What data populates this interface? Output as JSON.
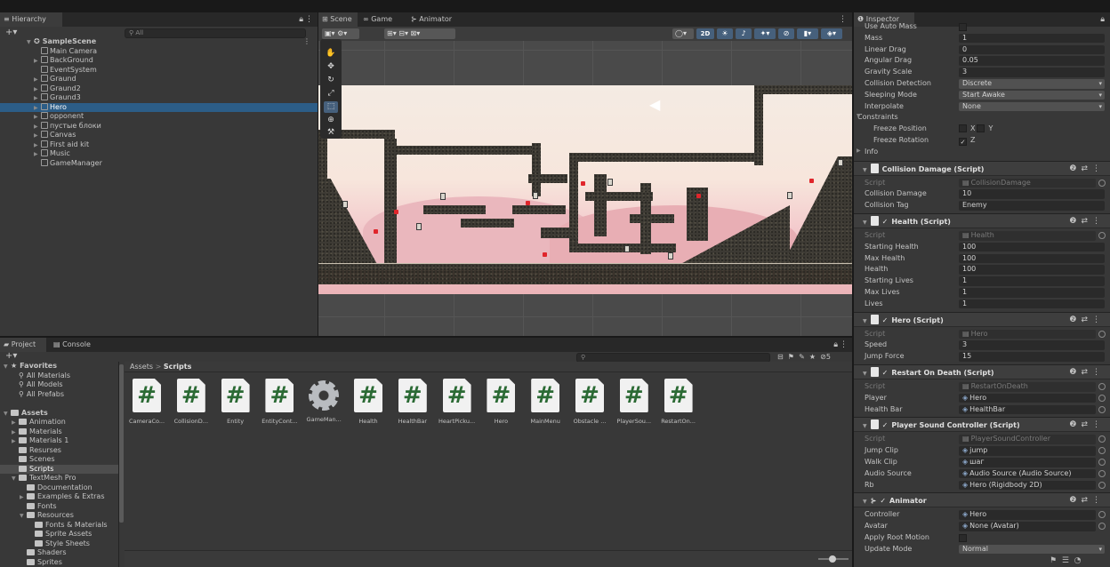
{
  "hierarchy": {
    "tab": "Hierarchy",
    "search_placeholder": "All",
    "items": [
      {
        "label": "SampleScene",
        "expand": "▼",
        "kind": "scene",
        "depth": 0
      },
      {
        "label": "Main Camera",
        "expand": "",
        "kind": "obj",
        "depth": 1
      },
      {
        "label": "BackGround",
        "expand": "▶",
        "kind": "obj",
        "depth": 1
      },
      {
        "label": "EventSystem",
        "expand": "",
        "kind": "obj",
        "depth": 1
      },
      {
        "label": "Graund",
        "expand": "▶",
        "kind": "obj",
        "depth": 1
      },
      {
        "label": "Graund2",
        "expand": "▶",
        "kind": "obj",
        "depth": 1
      },
      {
        "label": "Graund3",
        "expand": "▶",
        "kind": "obj",
        "depth": 1
      },
      {
        "label": "Hero",
        "expand": "▶",
        "kind": "obj",
        "depth": 1,
        "selected": true
      },
      {
        "label": "opponent",
        "expand": "▶",
        "kind": "obj",
        "depth": 1
      },
      {
        "label": "пустые блоки",
        "expand": "▶",
        "kind": "obj",
        "depth": 1
      },
      {
        "label": "Canvas",
        "expand": "▶",
        "kind": "obj",
        "depth": 1
      },
      {
        "label": "First aid kit",
        "expand": "▶",
        "kind": "obj",
        "depth": 1
      },
      {
        "label": "Music",
        "expand": "▶",
        "kind": "obj",
        "depth": 1
      },
      {
        "label": "GameManager",
        "expand": "",
        "kind": "obj",
        "depth": 1
      }
    ]
  },
  "scene_view": {
    "tabs": [
      "Scene",
      "Game",
      "Animator"
    ],
    "toolbar_2d": "2D"
  },
  "project": {
    "tabs": [
      "Project",
      "Console"
    ],
    "breadcrumb": [
      "Assets",
      "Scripts"
    ],
    "breadcrumb_sep": ">",
    "asset_count": "5",
    "tree": [
      {
        "label": "Favorites",
        "kind": "star",
        "depth": 0,
        "expand": "▼"
      },
      {
        "label": "All Materials",
        "kind": "search",
        "depth": 1,
        "expand": ""
      },
      {
        "label": "All Models",
        "kind": "search",
        "depth": 1,
        "expand": ""
      },
      {
        "label": "All Prefabs",
        "kind": "search",
        "depth": 1,
        "expand": ""
      },
      {
        "label": "",
        "kind": "gap",
        "depth": 0,
        "expand": ""
      },
      {
        "label": "Assets",
        "kind": "folder",
        "depth": 0,
        "expand": "▼"
      },
      {
        "label": "Animation",
        "kind": "folder",
        "depth": 1,
        "expand": "▶"
      },
      {
        "label": "Materials",
        "kind": "folder",
        "depth": 1,
        "expand": "▶"
      },
      {
        "label": "Materials 1",
        "kind": "folder",
        "depth": 1,
        "expand": "▶"
      },
      {
        "label": "Resurses",
        "kind": "folder",
        "depth": 1,
        "expand": ""
      },
      {
        "label": "Scenes",
        "kind": "folder",
        "depth": 1,
        "expand": ""
      },
      {
        "label": "Scripts",
        "kind": "folder",
        "depth": 1,
        "expand": "",
        "selected": true
      },
      {
        "label": "TextMesh Pro",
        "kind": "folder",
        "depth": 1,
        "expand": "▼"
      },
      {
        "label": "Documentation",
        "kind": "folder",
        "depth": 2,
        "expand": ""
      },
      {
        "label": "Examples & Extras",
        "kind": "folder",
        "depth": 2,
        "expand": "▶"
      },
      {
        "label": "Fonts",
        "kind": "folder",
        "depth": 2,
        "expand": ""
      },
      {
        "label": "Resources",
        "kind": "folder",
        "depth": 2,
        "expand": "▼"
      },
      {
        "label": "Fonts & Materials",
        "kind": "folder",
        "depth": 3,
        "expand": ""
      },
      {
        "label": "Sprite Assets",
        "kind": "folder",
        "depth": 3,
        "expand": ""
      },
      {
        "label": "Style Sheets",
        "kind": "folder",
        "depth": 3,
        "expand": ""
      },
      {
        "label": "Shaders",
        "kind": "folder",
        "depth": 2,
        "expand": ""
      },
      {
        "label": "Sprites",
        "kind": "folder",
        "depth": 2,
        "expand": ""
      }
    ],
    "assets": [
      {
        "name": "CameraCo...",
        "kind": "script"
      },
      {
        "name": "CollisionD...",
        "kind": "script"
      },
      {
        "name": "Entity",
        "kind": "script"
      },
      {
        "name": "EntityCont...",
        "kind": "script"
      },
      {
        "name": "GameMan...",
        "kind": "gear"
      },
      {
        "name": "Health",
        "kind": "script"
      },
      {
        "name": "HealthBar",
        "kind": "script"
      },
      {
        "name": "HeartPicku...",
        "kind": "script"
      },
      {
        "name": "Hero",
        "kind": "script"
      },
      {
        "name": "MainMenu",
        "kind": "script"
      },
      {
        "name": "Obstacle ...",
        "kind": "script"
      },
      {
        "name": "PlayerSou...",
        "kind": "script"
      },
      {
        "name": "RestartOn...",
        "kind": "script"
      }
    ]
  },
  "inspector": {
    "tab": "Inspector",
    "rows_top": [
      {
        "label": "Use Auto Mass",
        "value": "",
        "type": "toggle"
      },
      {
        "label": "Mass",
        "value": "1",
        "type": "field"
      },
      {
        "label": "Linear Drag",
        "value": "0",
        "type": "field"
      },
      {
        "label": "Angular Drag",
        "value": "0.05",
        "type": "field"
      },
      {
        "label": "Gravity Scale",
        "value": "3",
        "type": "field"
      },
      {
        "label": "Collision Detection",
        "value": "Discrete",
        "type": "dropdown"
      },
      {
        "label": "Sleeping Mode",
        "value": "Start Awake",
        "type": "dropdown"
      },
      {
        "label": "Interpolate",
        "value": "None",
        "type": "dropdown"
      }
    ],
    "constraints": {
      "label": "Constraints",
      "freeze_position": "Freeze Position",
      "freeze_position_axes": [
        "X",
        "Y"
      ],
      "freeze_rotation": "Freeze Rotation",
      "freeze_rotation_axes": [
        "Z"
      ],
      "info": "Info"
    },
    "components": [
      {
        "title": "Collision Damage (Script)",
        "has_toggle": false,
        "rows": [
          {
            "label": "Script",
            "value": "CollisionDamage",
            "type": "script"
          },
          {
            "label": "Collision Damage",
            "value": "10",
            "type": "field"
          },
          {
            "label": "Collision Tag",
            "value": "Enemy",
            "type": "field"
          }
        ]
      },
      {
        "title": "Health (Script)",
        "has_toggle": true,
        "rows": [
          {
            "label": "Script",
            "value": "Health",
            "type": "script"
          },
          {
            "label": "Starting Health",
            "value": "100",
            "type": "field"
          },
          {
            "label": "Max Health",
            "value": "100",
            "type": "field"
          },
          {
            "label": "Health",
            "value": "100",
            "type": "field"
          },
          {
            "label": "Starting Lives",
            "value": "1",
            "type": "field"
          },
          {
            "label": "Max Lives",
            "value": "1",
            "type": "field"
          },
          {
            "label": "Lives",
            "value": "1",
            "type": "field"
          }
        ]
      },
      {
        "title": "Hero (Script)",
        "has_toggle": true,
        "rows": [
          {
            "label": "Script",
            "value": "Hero",
            "type": "script"
          },
          {
            "label": "Speed",
            "value": "3",
            "type": "field"
          },
          {
            "label": "Jump Force",
            "value": "15",
            "type": "field"
          }
        ]
      },
      {
        "title": "Restart On Death (Script)",
        "has_toggle": true,
        "rows": [
          {
            "label": "Script",
            "value": "RestartOnDeath",
            "type": "script"
          },
          {
            "label": "Player",
            "value": "Hero",
            "type": "object"
          },
          {
            "label": "Health Bar",
            "value": "HealthBar",
            "type": "object"
          }
        ]
      },
      {
        "title": "Player Sound Controller (Script)",
        "has_toggle": true,
        "rows": [
          {
            "label": "Script",
            "value": "PlayerSoundController",
            "type": "script"
          },
          {
            "label": "Jump Clip",
            "value": "jump",
            "type": "object"
          },
          {
            "label": "Walk Clip",
            "value": "шаг",
            "type": "object"
          },
          {
            "label": "Audio Source",
            "value": "Audio Source (Audio Source)",
            "type": "object"
          },
          {
            "label": "Rb",
            "value": "Hero (Rigidbody 2D)",
            "type": "object"
          }
        ]
      },
      {
        "title": "Animator",
        "has_toggle": true,
        "rows": [
          {
            "label": "Controller",
            "value": "Hero",
            "type": "object"
          },
          {
            "label": "Avatar",
            "value": "None (Avatar)",
            "type": "object"
          },
          {
            "label": "Apply Root Motion",
            "value": "",
            "type": "toggle"
          },
          {
            "label": "Update Mode",
            "value": "Normal",
            "type": "dropdown"
          }
        ]
      }
    ]
  },
  "colors": {
    "accent_selection": "#2c5d87",
    "panel": "#383838",
    "tabbar": "#282828",
    "script_green": "#2b6a34",
    "sky_pink": "#f3c4c8"
  }
}
